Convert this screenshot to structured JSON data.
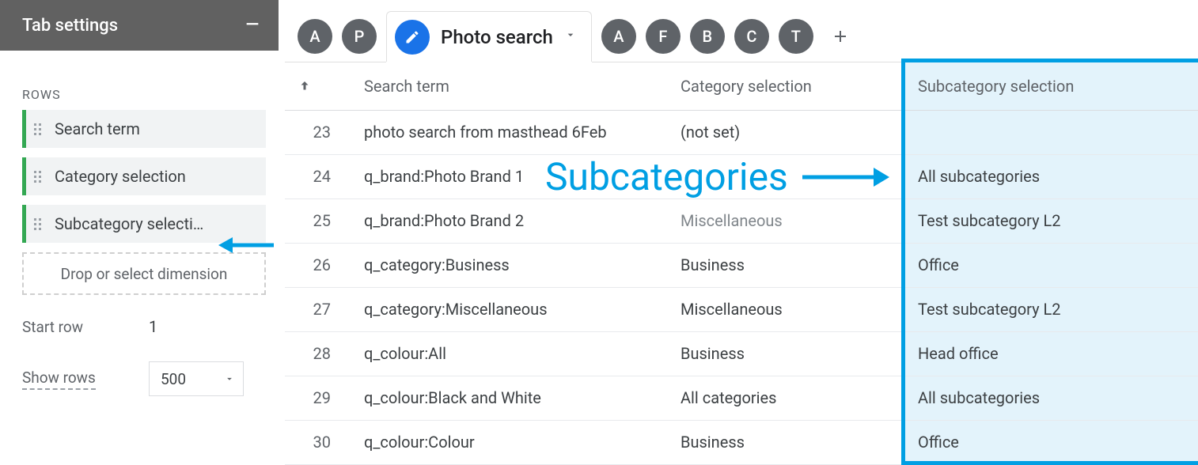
{
  "sidebar": {
    "title": "Tab settings",
    "rows_label": "ROWS",
    "chips": [
      {
        "label": "Search term"
      },
      {
        "label": "Category selection"
      },
      {
        "label": "Subcategory selecti…"
      }
    ],
    "drop_hint": "Drop or select dimension",
    "start_row_label": "Start row",
    "start_row_value": "1",
    "show_rows_label": "Show rows",
    "show_rows_value": "500"
  },
  "tabs": {
    "left_circles": [
      "A",
      "P"
    ],
    "active_label": "Photo search",
    "right_circles": [
      "A",
      "F",
      "B",
      "C",
      "T"
    ]
  },
  "table": {
    "headers": {
      "idx_icon": "arrow-up",
      "term": "Search term",
      "cat": "Category selection",
      "sub": "Subcategory selection"
    },
    "rows": [
      {
        "idx": "23",
        "term": "photo search from masthead 6Feb",
        "cat": "(not set)",
        "sub": ""
      },
      {
        "idx": "24",
        "term": "q_brand:Photo Brand 1",
        "cat": "",
        "sub": "All subcategories"
      },
      {
        "idx": "25",
        "term": "q_brand:Photo Brand 2",
        "cat": "Miscellaneous",
        "sub": "Test subcategory L2",
        "cat_muted": true
      },
      {
        "idx": "26",
        "term": "q_category:Business",
        "cat": "Business",
        "sub": "Office"
      },
      {
        "idx": "27",
        "term": "q_category:Miscellaneous",
        "cat": "Miscellaneous",
        "sub": "Test subcategory L2"
      },
      {
        "idx": "28",
        "term": "q_colour:All",
        "cat": "Business",
        "sub": "Head office"
      },
      {
        "idx": "29",
        "term": "q_colour:Black and White",
        "cat": "All categories",
        "sub": "All subcategories"
      },
      {
        "idx": "30",
        "term": "q_colour:Colour",
        "cat": "Business",
        "sub": "Office"
      }
    ]
  },
  "annotation": {
    "text": "Subcategories"
  }
}
